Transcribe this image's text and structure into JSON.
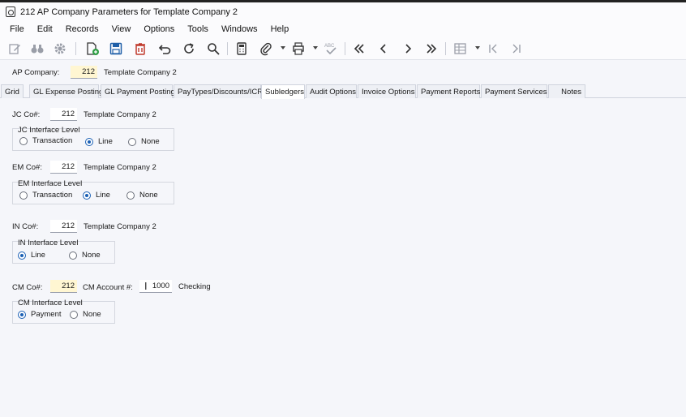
{
  "window": {
    "title": "212 AP Company Parameters for Template Company 2"
  },
  "menu": [
    "File",
    "Edit",
    "Records",
    "View",
    "Options",
    "Tools",
    "Windows",
    "Help"
  ],
  "toolbar": {
    "abc_label": "ABC"
  },
  "company": {
    "label": "AP Company:",
    "number": "212",
    "name": "Template Company 2"
  },
  "tabs": [
    "Grid",
    "GL Expense Posting",
    "GL Payment Posting",
    "PayTypes/Discounts/ICR",
    "Subledgers",
    "Audit Options",
    "Invoice Options",
    "Payment Reports",
    "Payment Services",
    "Notes"
  ],
  "active_tab": "Subledgers",
  "jc": {
    "label": "JC Co#:",
    "number": "212",
    "name": "Template Company 2",
    "group_title": "JC Interface Level",
    "options": [
      "Transaction",
      "Line",
      "None"
    ],
    "selected": "Line"
  },
  "em": {
    "label": "EM Co#:",
    "number": "212",
    "name": "Template Company 2",
    "group_title": "EM Interface Level",
    "options": [
      "Transaction",
      "Line",
      "None"
    ],
    "selected": "Line"
  },
  "in": {
    "label": "IN Co#:",
    "number": "212",
    "name": "Template Company 2",
    "group_title": "IN Interface Level",
    "options": [
      "Line",
      "None"
    ],
    "selected": "Line"
  },
  "cm": {
    "label": "CM Co#:",
    "number": "212",
    "account_label": "CM Account #:",
    "account_number": "1000",
    "account_name": "Checking",
    "group_title": "CM Interface Level",
    "options": [
      "Payment",
      "None"
    ],
    "selected": "Payment"
  },
  "colors": {
    "accent": "#1a5fb4",
    "delete_red": "#c0392b",
    "save_blue": "#1f5fa8",
    "field_yellow": "#fff6d2"
  }
}
